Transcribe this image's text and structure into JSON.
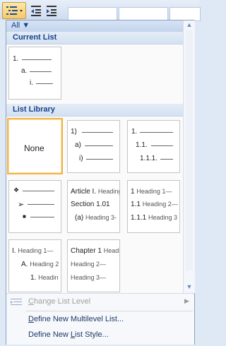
{
  "filter": {
    "label": "All ▼"
  },
  "sections": {
    "current": "Current List",
    "library": "List Library"
  },
  "current_list": {
    "levels": [
      "1.",
      "a.",
      "i."
    ]
  },
  "library": {
    "none": "None",
    "numbered": [
      "1)",
      "a)",
      "i)"
    ],
    "decimal": [
      "1.",
      "1.1.",
      "1.1.1."
    ],
    "article": [
      "Article I.",
      "Heading",
      "Section 1.01",
      "(a)",
      "Heading 3-"
    ],
    "heading_numbered": [
      "1",
      "Heading 1—",
      "1.1",
      "Heading 2—",
      "1.1.1",
      "Heading 3"
    ],
    "outline": [
      "I.",
      "Heading 1—",
      "A.",
      "Heading 2",
      "1.",
      "Headin"
    ],
    "chapter": [
      "Chapter 1",
      "Heading",
      "Heading 2—",
      "Heading 3—"
    ]
  },
  "menu": {
    "change": {
      "pre": "",
      "u": "C",
      "post": "hange List Level"
    },
    "define_new": {
      "pre": "",
      "u": "D",
      "post": "efine New Multilevel List..."
    },
    "define_style": {
      "pre": "Define New ",
      "u": "L",
      "post": "ist Style..."
    }
  }
}
